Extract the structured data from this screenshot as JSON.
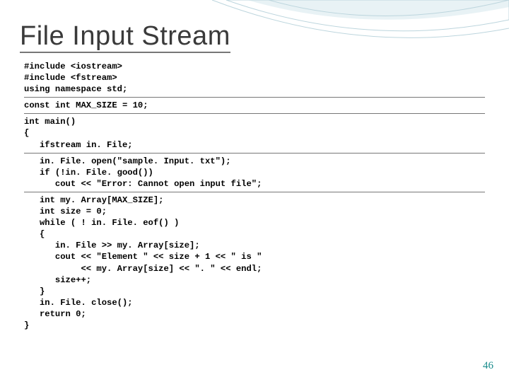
{
  "slide": {
    "title": "File Input Stream",
    "page_number": "46"
  },
  "code": {
    "block1": "#include <iostream>\n#include <fstream>\nusing namespace std;",
    "block2": "const int MAX_SIZE = 10;",
    "block3": "int main()\n{\n   ifstream in. File;",
    "block4": "   in. File. open(\"sample. Input. txt\");\n   if (!in. File. good())\n      cout << \"Error: Cannot open input file\";",
    "block5": "   int my. Array[MAX_SIZE];\n   int size = 0;\n   while ( ! in. File. eof() )\n   {\n      in. File >> my. Array[size];\n      cout << \"Element \" << size + 1 << \" is \"\n           << my. Array[size] << \". \" << endl;\n      size++;\n   }\n   in. File. close();\n   return 0;\n}"
  }
}
